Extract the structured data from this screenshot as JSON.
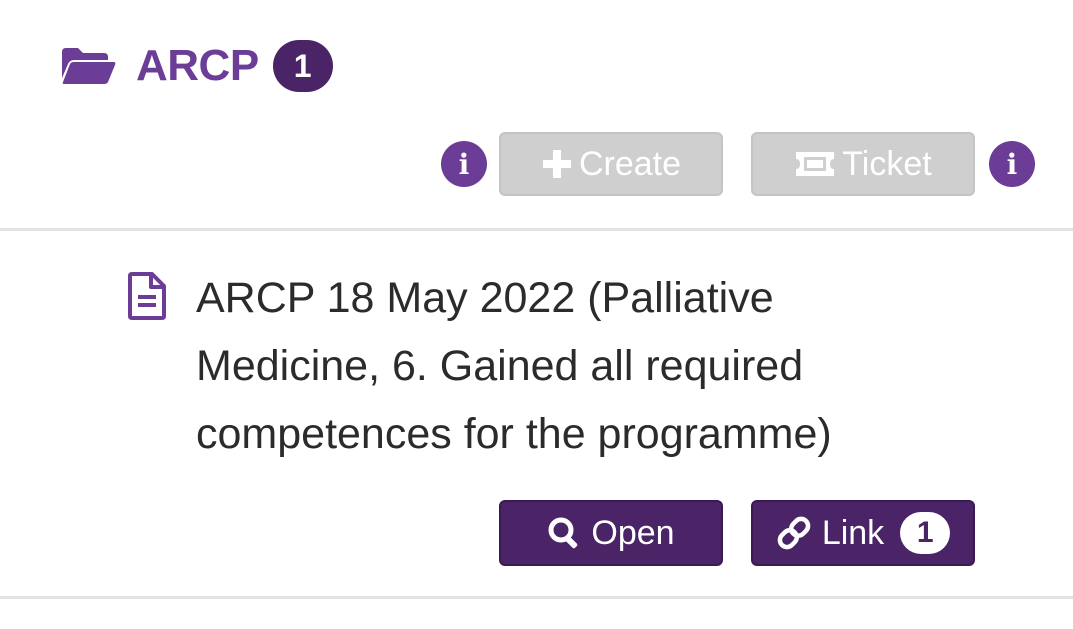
{
  "section": {
    "title": "ARCP",
    "count": "1",
    "folder_icon": "folder-open-icon",
    "accent_color": "#6b3d97",
    "badge_color": "#4a2466"
  },
  "toolbar": {
    "create_label": "Create",
    "ticket_label": "Ticket",
    "info_glyph": "i"
  },
  "item": {
    "icon": "document-icon",
    "text": "ARCP 18 May 2022 (Palliative Medicine, 6. Gained all required competences for the programme)",
    "open_label": "Open",
    "link_label": "Link",
    "link_count": "1"
  }
}
